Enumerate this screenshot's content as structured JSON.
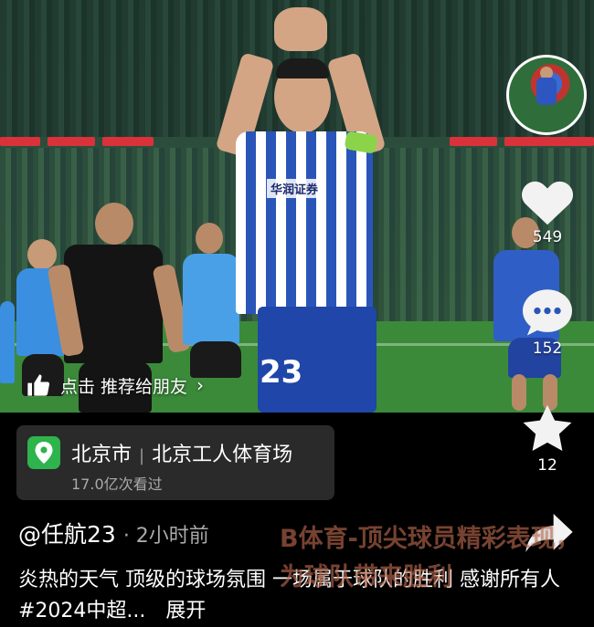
{
  "overlay": {
    "like_text": "点击 推荐给朋友"
  },
  "rail": {
    "like_count": "549",
    "comment_count": "152",
    "favorite_count": "12"
  },
  "location": {
    "city": "北京市",
    "place": "北京工人体育场",
    "views": "17.0亿次看过"
  },
  "post": {
    "author": "@任航23",
    "time": "· 2小时前",
    "caption": "炎热的天气 顶级的球场氛围 一场属于球队的胜利 感谢所有人#2024中超...",
    "more_label": "展开"
  },
  "photo": {
    "jersey_number": "23",
    "sponsor": "华润证券"
  },
  "watermark": "B体育-顶尖球员精彩表现，为球队带来胜利",
  "colors": {
    "location_pin": "#2fb34c",
    "shirt_blue": "#2a55b8",
    "led": "#d9323a"
  }
}
